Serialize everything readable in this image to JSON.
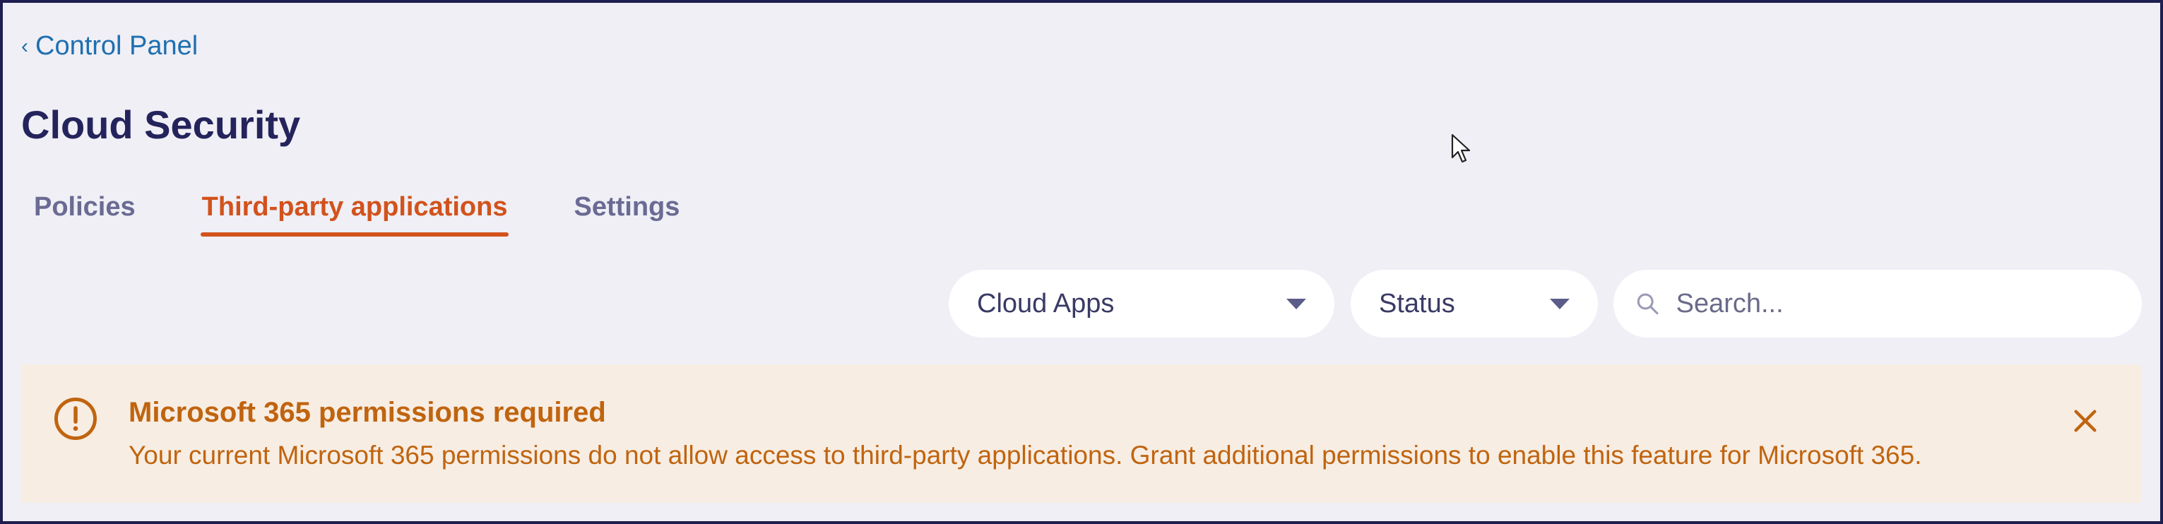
{
  "breadcrumb": {
    "chevron": "‹",
    "label": "Control Panel"
  },
  "page": {
    "title": "Cloud Security"
  },
  "tabs": [
    {
      "label": "Policies",
      "active": false
    },
    {
      "label": "Third-party applications",
      "active": true
    },
    {
      "label": "Settings",
      "active": false
    }
  ],
  "filters": {
    "apps": {
      "value": "Cloud Apps"
    },
    "status": {
      "value": "Status"
    },
    "search": {
      "placeholder": "Search..."
    }
  },
  "alert": {
    "title": "Microsoft 365 permissions required",
    "body": "Your current Microsoft 365 permissions do not allow access to third-party applications. Grant additional permissions to enable this feature for Microsoft 365.",
    "icon": "alert-circle-icon"
  },
  "colors": {
    "accent": "#d2521c",
    "link": "#1f6fb0",
    "title": "#24235b",
    "warning": "#c0640f",
    "warning_bg": "#f7ede3",
    "page_bg": "#efeff5",
    "frame": "#1e1f4f"
  }
}
